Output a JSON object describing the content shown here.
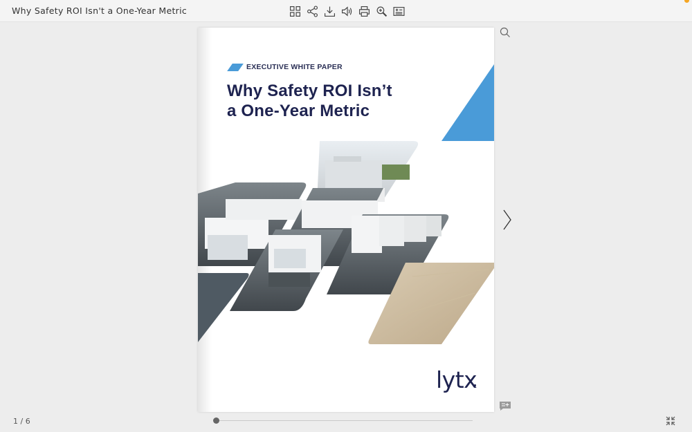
{
  "window": {
    "title": "Why Safety ROI Isn't a One-Year Metric"
  },
  "toolbar": {
    "icons": [
      "grid-icon",
      "share-icon",
      "download-icon",
      "sound-icon",
      "print-icon",
      "zoom-icon",
      "notes-icon"
    ]
  },
  "document": {
    "eyebrow": "EXECUTIVE WHITE PAPER",
    "title_line1": "Why Safety ROI Isn’t",
    "title_line2": "a One-Year Metric",
    "logo_text": "lytx"
  },
  "navigation": {
    "page_indicator": "1 / 6",
    "progress": 0.0
  },
  "colors": {
    "accent_blue": "#4a9bd8",
    "title_navy": "#1e2350",
    "notification_orange": "#f5a623"
  }
}
